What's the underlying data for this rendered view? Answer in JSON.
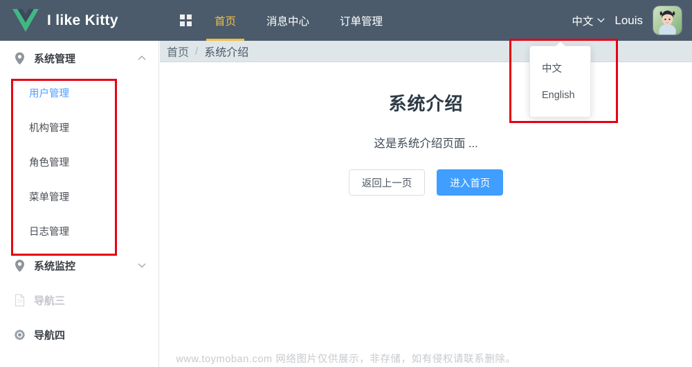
{
  "header": {
    "logo_icon": "vue-logo-icon",
    "brand_title": "I like Kitty",
    "grid_icon": "grid-apps-icon",
    "nav_items": [
      {
        "label": "首页",
        "active": true
      },
      {
        "label": "消息中心",
        "active": false
      },
      {
        "label": "订单管理",
        "active": false
      }
    ],
    "lang_label": "中文",
    "lang_chevron_icon": "chevron-down-icon",
    "user_name": "Louis",
    "avatar_icon": "user-avatar"
  },
  "lang_dropdown": {
    "options": [
      "中文",
      "English"
    ]
  },
  "sidebar": {
    "groups": [
      {
        "label": "系统管理",
        "icon": "location-pin-icon",
        "arrow_icon": "chevron-up-icon",
        "expanded": true,
        "items": [
          {
            "label": "用户管理",
            "active": true
          },
          {
            "label": "机构管理",
            "active": false
          },
          {
            "label": "角色管理",
            "active": false
          },
          {
            "label": "菜单管理",
            "active": false
          },
          {
            "label": "日志管理",
            "active": false
          }
        ]
      },
      {
        "label": "系统监控",
        "icon": "location-pin-icon",
        "arrow_icon": "chevron-down-icon",
        "expanded": false,
        "items": []
      }
    ],
    "plain_items": [
      {
        "label": "导航三",
        "icon": "document-icon",
        "disabled": true
      },
      {
        "label": "导航四",
        "icon": "gear-icon",
        "disabled": false
      }
    ]
  },
  "breadcrumb": {
    "home": "首页",
    "separator": "/",
    "current": "系统介绍"
  },
  "main": {
    "heading": "系统介绍",
    "description": "这是系统介绍页面 ...",
    "back_button": "返回上一页",
    "home_button": "进入首页"
  },
  "watermark": "www.toymoban.com 网络图片仅供展示，非存储，如有侵权请联系删除。",
  "colors": {
    "header_bg": "#4b5b6b",
    "accent_yellow": "#f0c040",
    "primary_blue": "#409eff",
    "active_link_blue": "#4d9dfd",
    "breadcrumb_bg": "#dfe6ea",
    "annotation_red": "#e60012"
  }
}
